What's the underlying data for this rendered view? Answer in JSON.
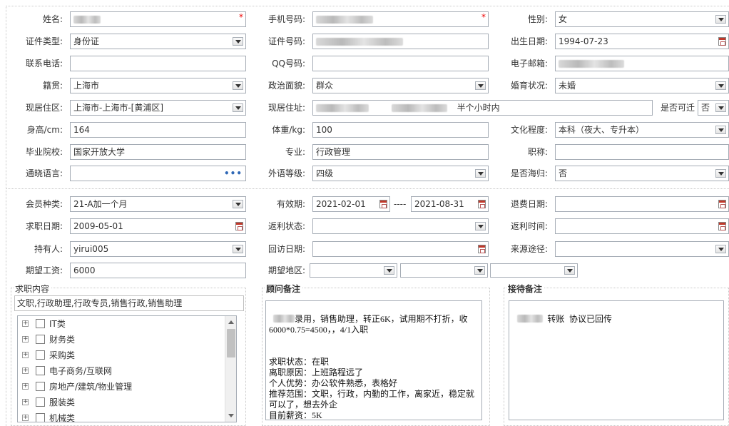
{
  "form": {
    "name": {
      "label": "姓名:",
      "value": "",
      "required": "*"
    },
    "phone": {
      "label": "手机号码:",
      "value": "",
      "required": "*"
    },
    "gender": {
      "label": "性别:",
      "value": "女"
    },
    "id_type": {
      "label": "证件类型:",
      "value": "身份证"
    },
    "id_number": {
      "label": "证件号码:",
      "value": ""
    },
    "birth_date": {
      "label": "出生日期:",
      "value": "1994-07-23"
    },
    "contact_phone": {
      "label": "联系电话:",
      "value": ""
    },
    "qq": {
      "label": "QQ号码:",
      "value": ""
    },
    "email": {
      "label": "电子邮箱:",
      "value": ""
    },
    "native_place": {
      "label": "籍贯:",
      "value": "上海市"
    },
    "political_status": {
      "label": "政治面貌:",
      "value": "群众"
    },
    "marital_status": {
      "label": "婚育状况:",
      "value": "未婚"
    },
    "residence_area": {
      "label": "现居住区:",
      "value": "上海市-上海市-[黄浦区]"
    },
    "residence_address": {
      "label": "现居住址:",
      "value_suffix": "半个小时内"
    },
    "relocatable": {
      "label": "是否可迁",
      "value": "否"
    },
    "height": {
      "label": "身高/cm:",
      "value": "164"
    },
    "weight": {
      "label": "体重/kg:",
      "value": "100"
    },
    "education": {
      "label": "文化程度:",
      "value": "本科（夜大、专升本）"
    },
    "school": {
      "label": "毕业院校:",
      "value": "国家开放大学"
    },
    "major": {
      "label": "专业:",
      "value": "行政管理"
    },
    "title": {
      "label": "职称:",
      "value": ""
    },
    "language": {
      "label": "通晓语言:",
      "value": "",
      "more": "•••"
    },
    "foreign_level": {
      "label": "外语等级:",
      "value": "四级"
    },
    "overseas": {
      "label": "是否海归:",
      "value": "否"
    }
  },
  "membership": {
    "member_type": {
      "label": "会员种类:",
      "value": "21-A加一个月"
    },
    "valid_period": {
      "label": "有效期:",
      "start": "2021-02-01",
      "separator": "----",
      "end": "2021-08-31"
    },
    "refund_date": {
      "label": "退费日期:",
      "value": ""
    },
    "job_date": {
      "label": "求职日期:",
      "value": "2009-05-01"
    },
    "rebate_status": {
      "label": "返利状态:",
      "value": ""
    },
    "rebate_time": {
      "label": "返利时间:",
      "value": ""
    },
    "holder": {
      "label": "持有人:",
      "value": "yirui005"
    },
    "visit_date": {
      "label": "回访日期:",
      "value": ""
    },
    "source": {
      "label": "来源途径:",
      "value": ""
    },
    "expected_salary": {
      "label": "期望工资:",
      "value": "6000"
    },
    "expected_region": {
      "label": "期望地区:",
      "values": [
        "",
        "",
        ""
      ]
    }
  },
  "job_content": {
    "title": "求职内容",
    "selected": "文职,行政助理,行政专员,销售行政,销售助理",
    "categories": [
      "IT类",
      "财务类",
      "采购类",
      "电子商务/互联网",
      "房地产/建筑/物业管理",
      "服装类",
      "机械类"
    ]
  },
  "advisor_notes": {
    "title": "顾问备注",
    "text": "录用，销售助理，转正6K，试用期不打折，收6000*0.75=4500，，4/1入职\n\n\n求职状态：在职\n离职原因：上班路程远了\n个人优势：办公软件熟悉，表格好\n推荐范围：文职，行政，内勤的工作，离家近，稳定就可以了，想去外企\n目前薪资：5K"
  },
  "reception_notes": {
    "title": "接待备注",
    "text": "转账  协议已回传"
  }
}
